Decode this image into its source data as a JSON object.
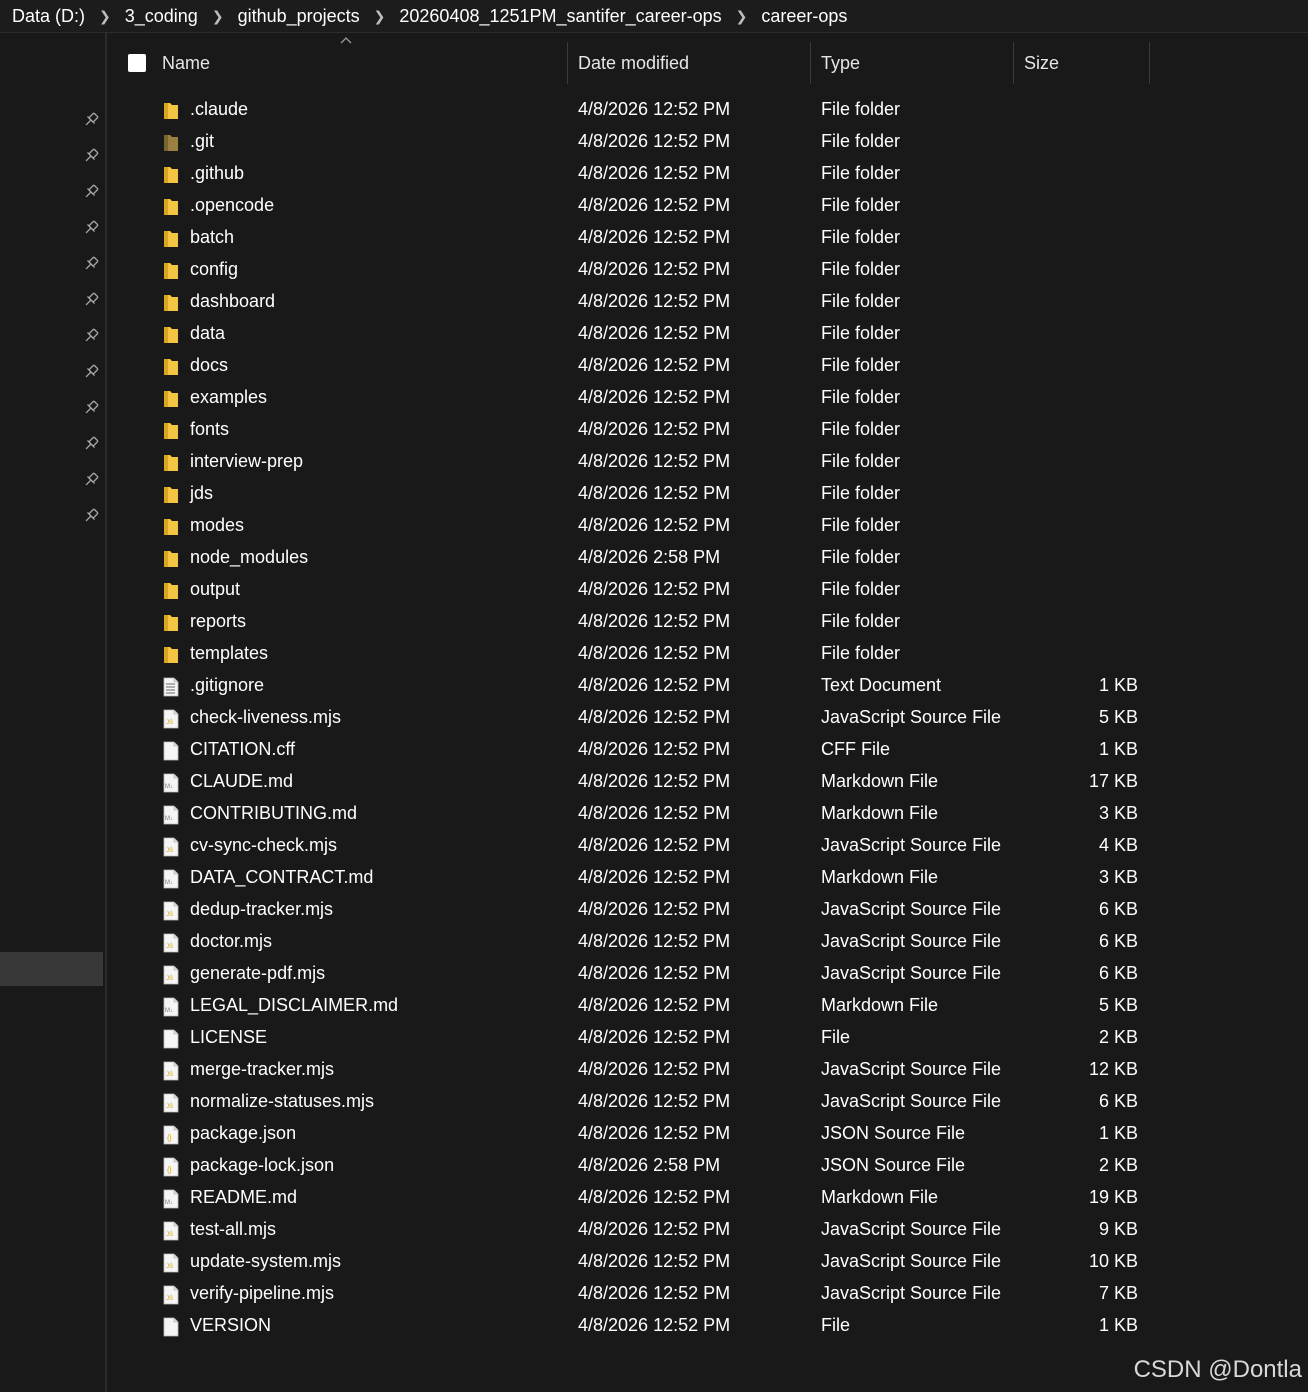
{
  "breadcrumb": [
    "Data (D:)",
    "3_coding",
    "github_projects",
    "20260408_1251PM_santifer_career-ops",
    "career-ops"
  ],
  "columns": {
    "name": "Name",
    "date": "Date modified",
    "type": "Type",
    "size": "Size"
  },
  "files": [
    {
      "name": ".claude",
      "date": "4/8/2026 12:52 PM",
      "type": "File folder",
      "size": "",
      "icon": "folder-icon"
    },
    {
      "name": ".git",
      "date": "4/8/2026 12:52 PM",
      "type": "File folder",
      "size": "",
      "icon": "folder-hidden-icon"
    },
    {
      "name": ".github",
      "date": "4/8/2026 12:52 PM",
      "type": "File folder",
      "size": "",
      "icon": "folder-icon"
    },
    {
      "name": ".opencode",
      "date": "4/8/2026 12:52 PM",
      "type": "File folder",
      "size": "",
      "icon": "folder-icon"
    },
    {
      "name": "batch",
      "date": "4/8/2026 12:52 PM",
      "type": "File folder",
      "size": "",
      "icon": "folder-icon"
    },
    {
      "name": "config",
      "date": "4/8/2026 12:52 PM",
      "type": "File folder",
      "size": "",
      "icon": "folder-icon"
    },
    {
      "name": "dashboard",
      "date": "4/8/2026 12:52 PM",
      "type": "File folder",
      "size": "",
      "icon": "folder-icon"
    },
    {
      "name": "data",
      "date": "4/8/2026 12:52 PM",
      "type": "File folder",
      "size": "",
      "icon": "folder-icon"
    },
    {
      "name": "docs",
      "date": "4/8/2026 12:52 PM",
      "type": "File folder",
      "size": "",
      "icon": "folder-icon"
    },
    {
      "name": "examples",
      "date": "4/8/2026 12:52 PM",
      "type": "File folder",
      "size": "",
      "icon": "folder-icon"
    },
    {
      "name": "fonts",
      "date": "4/8/2026 12:52 PM",
      "type": "File folder",
      "size": "",
      "icon": "folder-icon"
    },
    {
      "name": "interview-prep",
      "date": "4/8/2026 12:52 PM",
      "type": "File folder",
      "size": "",
      "icon": "folder-icon"
    },
    {
      "name": "jds",
      "date": "4/8/2026 12:52 PM",
      "type": "File folder",
      "size": "",
      "icon": "folder-icon"
    },
    {
      "name": "modes",
      "date": "4/8/2026 12:52 PM",
      "type": "File folder",
      "size": "",
      "icon": "folder-icon"
    },
    {
      "name": "node_modules",
      "date": "4/8/2026 2:58 PM",
      "type": "File folder",
      "size": "",
      "icon": "folder-icon"
    },
    {
      "name": "output",
      "date": "4/8/2026 12:52 PM",
      "type": "File folder",
      "size": "",
      "icon": "folder-icon"
    },
    {
      "name": "reports",
      "date": "4/8/2026 12:52 PM",
      "type": "File folder",
      "size": "",
      "icon": "folder-icon"
    },
    {
      "name": "templates",
      "date": "4/8/2026 12:52 PM",
      "type": "File folder",
      "size": "",
      "icon": "folder-icon"
    },
    {
      "name": ".gitignore",
      "date": "4/8/2026 12:52 PM",
      "type": "Text Document",
      "size": "1 KB",
      "icon": "text-file-icon"
    },
    {
      "name": "check-liveness.mjs",
      "date": "4/8/2026 12:52 PM",
      "type": "JavaScript Source File",
      "size": "5 KB",
      "icon": "js-file-icon"
    },
    {
      "name": "CITATION.cff",
      "date": "4/8/2026 12:52 PM",
      "type": "CFF File",
      "size": "1 KB",
      "icon": "blank-file-icon"
    },
    {
      "name": "CLAUDE.md",
      "date": "4/8/2026 12:52 PM",
      "type": "Markdown File",
      "size": "17 KB",
      "icon": "markdown-file-icon"
    },
    {
      "name": "CONTRIBUTING.md",
      "date": "4/8/2026 12:52 PM",
      "type": "Markdown File",
      "size": "3 KB",
      "icon": "markdown-file-icon"
    },
    {
      "name": "cv-sync-check.mjs",
      "date": "4/8/2026 12:52 PM",
      "type": "JavaScript Source File",
      "size": "4 KB",
      "icon": "js-file-icon"
    },
    {
      "name": "DATA_CONTRACT.md",
      "date": "4/8/2026 12:52 PM",
      "type": "Markdown File",
      "size": "3 KB",
      "icon": "markdown-file-icon"
    },
    {
      "name": "dedup-tracker.mjs",
      "date": "4/8/2026 12:52 PM",
      "type": "JavaScript Source File",
      "size": "6 KB",
      "icon": "js-file-icon"
    },
    {
      "name": "doctor.mjs",
      "date": "4/8/2026 12:52 PM",
      "type": "JavaScript Source File",
      "size": "6 KB",
      "icon": "js-file-icon"
    },
    {
      "name": "generate-pdf.mjs",
      "date": "4/8/2026 12:52 PM",
      "type": "JavaScript Source File",
      "size": "6 KB",
      "icon": "js-file-icon"
    },
    {
      "name": "LEGAL_DISCLAIMER.md",
      "date": "4/8/2026 12:52 PM",
      "type": "Markdown File",
      "size": "5 KB",
      "icon": "markdown-file-icon"
    },
    {
      "name": "LICENSE",
      "date": "4/8/2026 12:52 PM",
      "type": "File",
      "size": "2 KB",
      "icon": "blank-file-icon"
    },
    {
      "name": "merge-tracker.mjs",
      "date": "4/8/2026 12:52 PM",
      "type": "JavaScript Source File",
      "size": "12 KB",
      "icon": "js-file-icon"
    },
    {
      "name": "normalize-statuses.mjs",
      "date": "4/8/2026 12:52 PM",
      "type": "JavaScript Source File",
      "size": "6 KB",
      "icon": "js-file-icon"
    },
    {
      "name": "package.json",
      "date": "4/8/2026 12:52 PM",
      "type": "JSON Source File",
      "size": "1 KB",
      "icon": "json-file-icon"
    },
    {
      "name": "package-lock.json",
      "date": "4/8/2026 2:58 PM",
      "type": "JSON Source File",
      "size": "2 KB",
      "icon": "json-file-icon"
    },
    {
      "name": "README.md",
      "date": "4/8/2026 12:52 PM",
      "type": "Markdown File",
      "size": "19 KB",
      "icon": "markdown-file-icon"
    },
    {
      "name": "test-all.mjs",
      "date": "4/8/2026 12:52 PM",
      "type": "JavaScript Source File",
      "size": "9 KB",
      "icon": "js-file-icon"
    },
    {
      "name": "update-system.mjs",
      "date": "4/8/2026 12:52 PM",
      "type": "JavaScript Source File",
      "size": "10 KB",
      "icon": "js-file-icon"
    },
    {
      "name": "verify-pipeline.mjs",
      "date": "4/8/2026 12:52 PM",
      "type": "JavaScript Source File",
      "size": "7 KB",
      "icon": "js-file-icon"
    },
    {
      "name": "VERSION",
      "date": "4/8/2026 12:52 PM",
      "type": "File",
      "size": "1 KB",
      "icon": "blank-file-icon"
    }
  ],
  "watermark": "CSDN @Dontla",
  "colors": {
    "folder": "#f4c542",
    "folder_hidden": "#9a8040",
    "background": "#191919"
  }
}
